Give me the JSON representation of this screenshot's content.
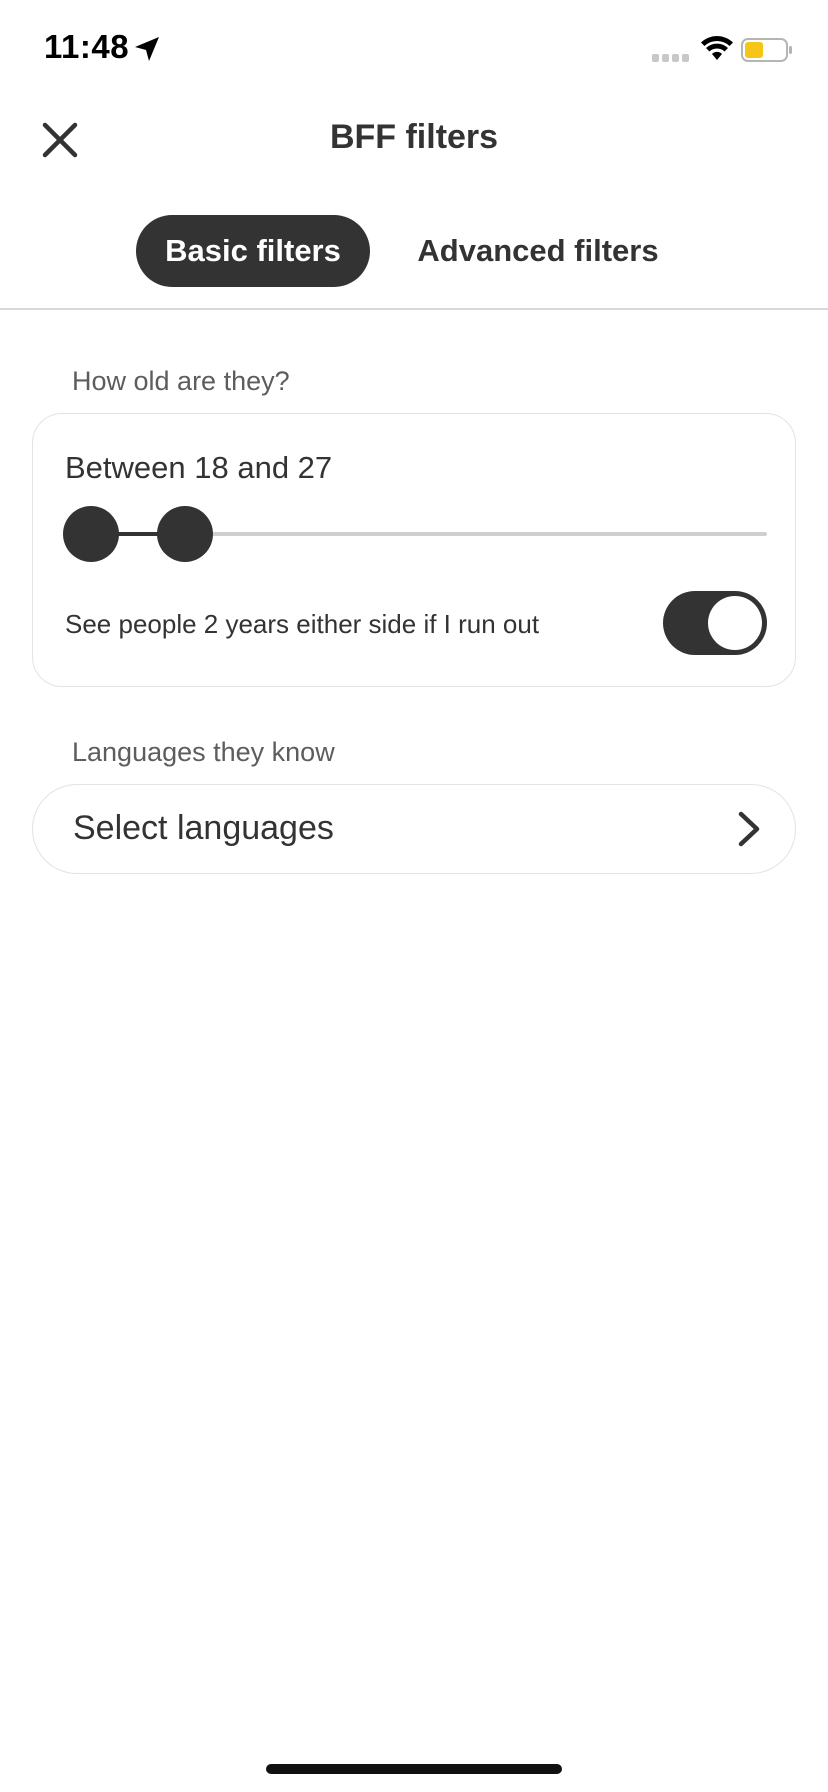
{
  "status_bar": {
    "time": "11:48",
    "icons": [
      "location-arrow-icon",
      "signal-icon",
      "wifi-icon",
      "battery-icon"
    ],
    "battery_color": "#f5c518"
  },
  "header": {
    "close_icon": "close-icon",
    "title": "BFF filters"
  },
  "tabs": [
    {
      "label": "Basic filters",
      "selected": true
    },
    {
      "label": "Advanced filters",
      "selected": false
    }
  ],
  "age_section": {
    "label": "How old are they?",
    "range_text": "Between 18 and 27",
    "range_min": 18,
    "range_max": 27,
    "expand_label": "See people 2 years either side if I run out",
    "expand_enabled": true
  },
  "languages_section": {
    "label": "Languages they know",
    "select_label": "Select languages"
  },
  "colors": {
    "accent_dark": "#333333",
    "background": "#ffffff",
    "border": "#e3e3e3"
  }
}
